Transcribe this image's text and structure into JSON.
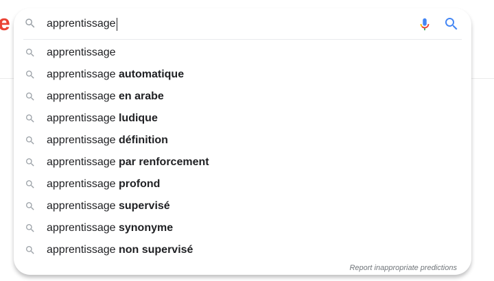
{
  "logo_fragment": "e",
  "search": {
    "query": "apprentissage",
    "icons": {
      "leading": "search-icon",
      "voice": "mic-icon",
      "submit": "search-icon"
    }
  },
  "suggestions": [
    {
      "prefix": "apprentissage",
      "completion": ""
    },
    {
      "prefix": "apprentissage",
      "completion": "automatique"
    },
    {
      "prefix": "apprentissage",
      "completion": "en arabe"
    },
    {
      "prefix": "apprentissage",
      "completion": "ludique"
    },
    {
      "prefix": "apprentissage",
      "completion": "définition"
    },
    {
      "prefix": "apprentissage",
      "completion": "par renforcement"
    },
    {
      "prefix": "apprentissage",
      "completion": "profond"
    },
    {
      "prefix": "apprentissage",
      "completion": "supervisé"
    },
    {
      "prefix": "apprentissage",
      "completion": "synonyme"
    },
    {
      "prefix": "apprentissage",
      "completion": "non supervisé"
    }
  ],
  "footer": {
    "report_label": "Report inappropriate predictions"
  },
  "colors": {
    "logo_red": "#ea4335",
    "search_blue": "#4285f4",
    "icon_gray": "#9aa0a6",
    "text": "#202124"
  }
}
